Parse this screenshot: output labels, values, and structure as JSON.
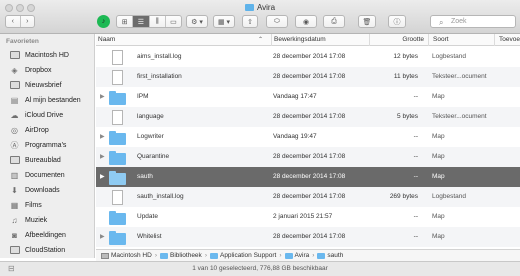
{
  "window": {
    "title": "Avira"
  },
  "toolbar": {
    "back": "‹",
    "forward": "›",
    "spotify": "♪",
    "view_icon": "⊞",
    "view_list": "☰",
    "view_columns": "⫼",
    "view_coverflow": "▭",
    "action": "⚙ ▾",
    "arrange": "▦ ▾",
    "share": "⇧",
    "tag": "⬭",
    "quicklook": "◉",
    "connect": "⎙",
    "trash": "🗑",
    "info": "ⓘ",
    "search_placeholder": "Zoek"
  },
  "sidebar": {
    "header": "Favorieten",
    "items": [
      {
        "label": "Macintosh HD",
        "icon": "hard-drive-icon"
      },
      {
        "label": "Dropbox",
        "icon": "dropbox-icon"
      },
      {
        "label": "Nieuwsbrief",
        "icon": "folder-icon"
      },
      {
        "label": "Al mijn bestanden",
        "icon": "all-files-icon"
      },
      {
        "label": "iCloud Drive",
        "icon": "cloud-icon"
      },
      {
        "label": "AirDrop",
        "icon": "airdrop-icon"
      },
      {
        "label": "Programma's",
        "icon": "applications-icon"
      },
      {
        "label": "Bureaublad",
        "icon": "desktop-icon"
      },
      {
        "label": "Documenten",
        "icon": "documents-icon"
      },
      {
        "label": "Downloads",
        "icon": "downloads-icon"
      },
      {
        "label": "Films",
        "icon": "movies-icon"
      },
      {
        "label": "Muziek",
        "icon": "music-icon"
      },
      {
        "label": "Afbeeldingen",
        "icon": "pictures-icon"
      },
      {
        "label": "CloudStation",
        "icon": "folder-icon"
      }
    ]
  },
  "columns": {
    "name": "Naam",
    "date": "Bewerkingsdatum",
    "size": "Grootte",
    "kind": "Soort",
    "added": "Toevoe"
  },
  "files": [
    {
      "name": "aims_install.log",
      "date": "28 december 2014 17:08",
      "size": "12 bytes",
      "kind": "Logbestand",
      "added": "",
      "type": "doc",
      "expandable": false,
      "selected": false
    },
    {
      "name": "first_installation",
      "date": "28 december 2014 17:08",
      "size": "11 bytes",
      "kind": "Teksteer...ocument",
      "added": "",
      "type": "doc",
      "expandable": false,
      "selected": false
    },
    {
      "name": "IPM",
      "date": "Vandaag 17:47",
      "size": "--",
      "kind": "Map",
      "added": "",
      "type": "folder",
      "expandable": true,
      "selected": false
    },
    {
      "name": "language",
      "date": "28 december 2014 17:08",
      "size": "5 bytes",
      "kind": "Teksteer...ocument",
      "added": "",
      "type": "doc",
      "expandable": false,
      "selected": false
    },
    {
      "name": "Logwriter",
      "date": "Vandaag 19:47",
      "size": "--",
      "kind": "Map",
      "added": "",
      "type": "folder",
      "expandable": true,
      "selected": false
    },
    {
      "name": "Quarantine",
      "date": "28 december 2014 17:08",
      "size": "--",
      "kind": "Map",
      "added": "",
      "type": "folder",
      "expandable": true,
      "selected": false
    },
    {
      "name": "sauth",
      "date": "28 december 2014 17:08",
      "size": "--",
      "kind": "Map",
      "added": "",
      "type": "folder",
      "expandable": true,
      "selected": true
    },
    {
      "name": "sauth_install.log",
      "date": "28 december 2014 17:08",
      "size": "269 bytes",
      "kind": "Logbestand",
      "added": "",
      "type": "doc",
      "expandable": false,
      "selected": false
    },
    {
      "name": "Update",
      "date": "2 januari 2015 21:57",
      "size": "--",
      "kind": "Map",
      "added": "",
      "type": "folder",
      "expandable": false,
      "selected": false
    },
    {
      "name": "Whitelist",
      "date": "28 december 2014 17:08",
      "size": "--",
      "kind": "Map",
      "added": "",
      "type": "folder",
      "expandable": true,
      "selected": false
    }
  ],
  "pathbar": [
    "Macintosh HD",
    "Bibliotheek",
    "Application Support",
    "Avira",
    "sauth"
  ],
  "status": "1 van 10 geselecteerd, 776,88 GB beschikbaar"
}
